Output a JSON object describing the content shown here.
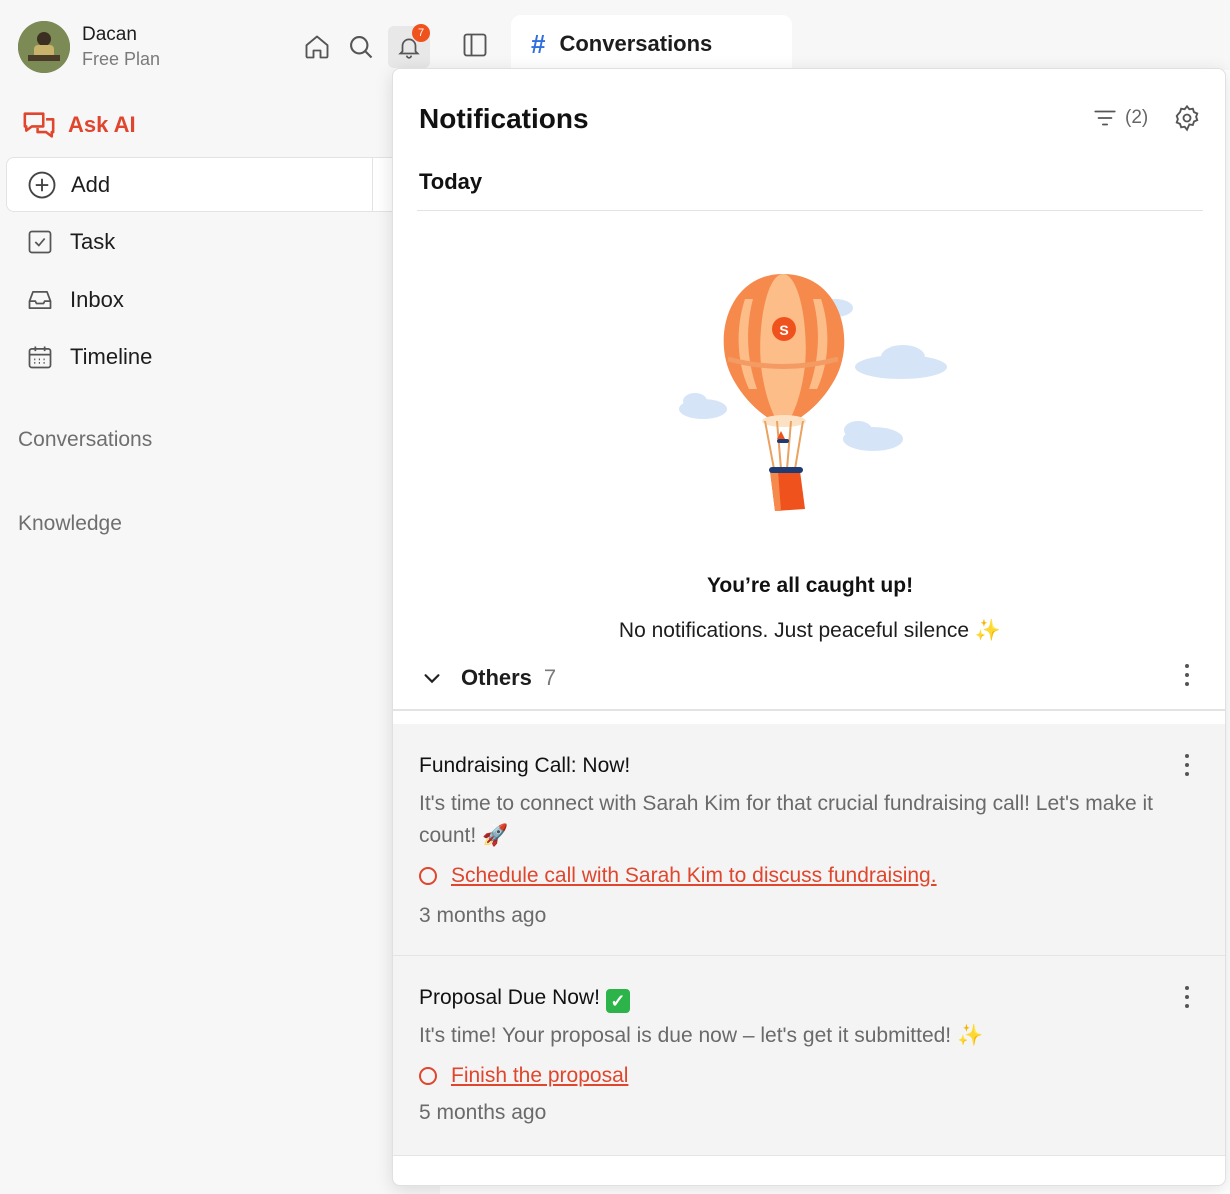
{
  "user": {
    "name": "Dacan",
    "plan": "Free Plan"
  },
  "notifications_badge": "7",
  "tab": {
    "hash": "#",
    "label": "Conversations"
  },
  "sidebar": {
    "ask_ai": "Ask AI",
    "add": "Add",
    "items": [
      {
        "label": "Task",
        "icon": "task-icon"
      },
      {
        "label": "Inbox",
        "icon": "inbox-icon"
      },
      {
        "label": "Timeline",
        "icon": "calendar-icon"
      }
    ],
    "sections": [
      "Conversations",
      "Knowledge"
    ]
  },
  "panel": {
    "title": "Notifications",
    "filter_count": "(2)",
    "today": "Today",
    "empty_title": "You’re all caught up!",
    "empty_sub": "No notifications. Just peaceful silence ✨",
    "others_label": "Others",
    "others_count": "7",
    "cards": [
      {
        "title": "Fundraising Call: Now!",
        "body": "It's time to connect with Sarah Kim for that crucial fundraising call! Let's make it count! 🚀",
        "link": "Schedule call with Sarah Kim to discuss fundraising.",
        "time": "3 months ago"
      },
      {
        "title": "Proposal Due Now!",
        "body": "It's time! Your proposal is due now – let's get it submitted! ✨",
        "link": "Finish the proposal",
        "time": "5 months ago"
      }
    ]
  },
  "colors": {
    "accent": "#e0462d",
    "hash": "#2f6fe0",
    "badge": "#f0521e"
  }
}
